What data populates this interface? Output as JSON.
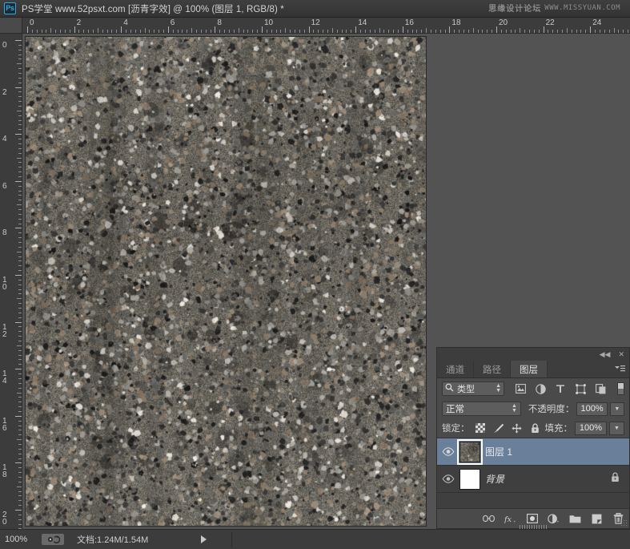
{
  "titlebar": {
    "logo": "Ps",
    "title": "PS学堂  www.52psxt.com [沥青字效] @ 100% (图层 1, RGB/8) *",
    "watermark_cn": "思缘设计论坛",
    "watermark_en": "WWW.MISSYUAN.COM"
  },
  "rulers": {
    "unit_step": 2,
    "h_labels": [
      "0",
      "2",
      "4",
      "6",
      "8",
      "10",
      "12",
      "14",
      "16",
      "18",
      "20",
      "22",
      "24"
    ],
    "v_labels": [
      "0",
      "2",
      "4",
      "6",
      "8",
      "10",
      "12",
      "14",
      "16",
      "18",
      "20"
    ]
  },
  "canvas": {
    "document_name": "沥青字效",
    "zoom": "100%",
    "color_mode": "RGB/8",
    "texture": "asphalt-gravel"
  },
  "statusbar": {
    "zoom_value": "100%",
    "three_d_icon": "3d-rotate-icon",
    "doc_label": "文档:1.24M/1.54M",
    "expand_arrow": "▶"
  },
  "panel": {
    "collapse_label": "◀◀",
    "close_label": "✕",
    "menu_label": "≡",
    "tabs": [
      {
        "label": "通道",
        "active": false
      },
      {
        "label": "路径",
        "active": false
      },
      {
        "label": "图层",
        "active": true
      }
    ],
    "filter": {
      "search_icon": "search-icon",
      "type_label": "类型",
      "icons": [
        "pixel-layer-icon",
        "adjustment-layer-icon",
        "type-layer-icon",
        "shape-layer-icon",
        "smart-object-icon"
      ],
      "toggle": "filter-toggle"
    },
    "blend": {
      "mode": "正常",
      "opacity_label": "不透明度：",
      "opacity_value": "100%"
    },
    "lock": {
      "label": "锁定：",
      "icons": [
        "transparency-lock-icon",
        "image-lock-icon",
        "position-lock-icon",
        "all-lock-icon"
      ],
      "fill_label": "填充：",
      "fill_value": "100%"
    },
    "layers": [
      {
        "name": "图层 1",
        "selected": true,
        "visible": true,
        "locked": false,
        "italic": false,
        "thumb": "texture"
      },
      {
        "name": "背景",
        "selected": false,
        "visible": true,
        "locked": true,
        "italic": true,
        "thumb": "white"
      }
    ],
    "bottom_icons": [
      "link-icon",
      "fx-icon",
      "mask-icon",
      "adjustment-icon",
      "group-icon",
      "new-layer-icon",
      "delete-icon"
    ]
  },
  "colors": {
    "accent_selection": "#6a7f99",
    "panel_bg": "#4a4a4a",
    "list_bg": "#3f3f3f",
    "app_bg": "#535353",
    "logo_blue": "#31a8e0"
  }
}
